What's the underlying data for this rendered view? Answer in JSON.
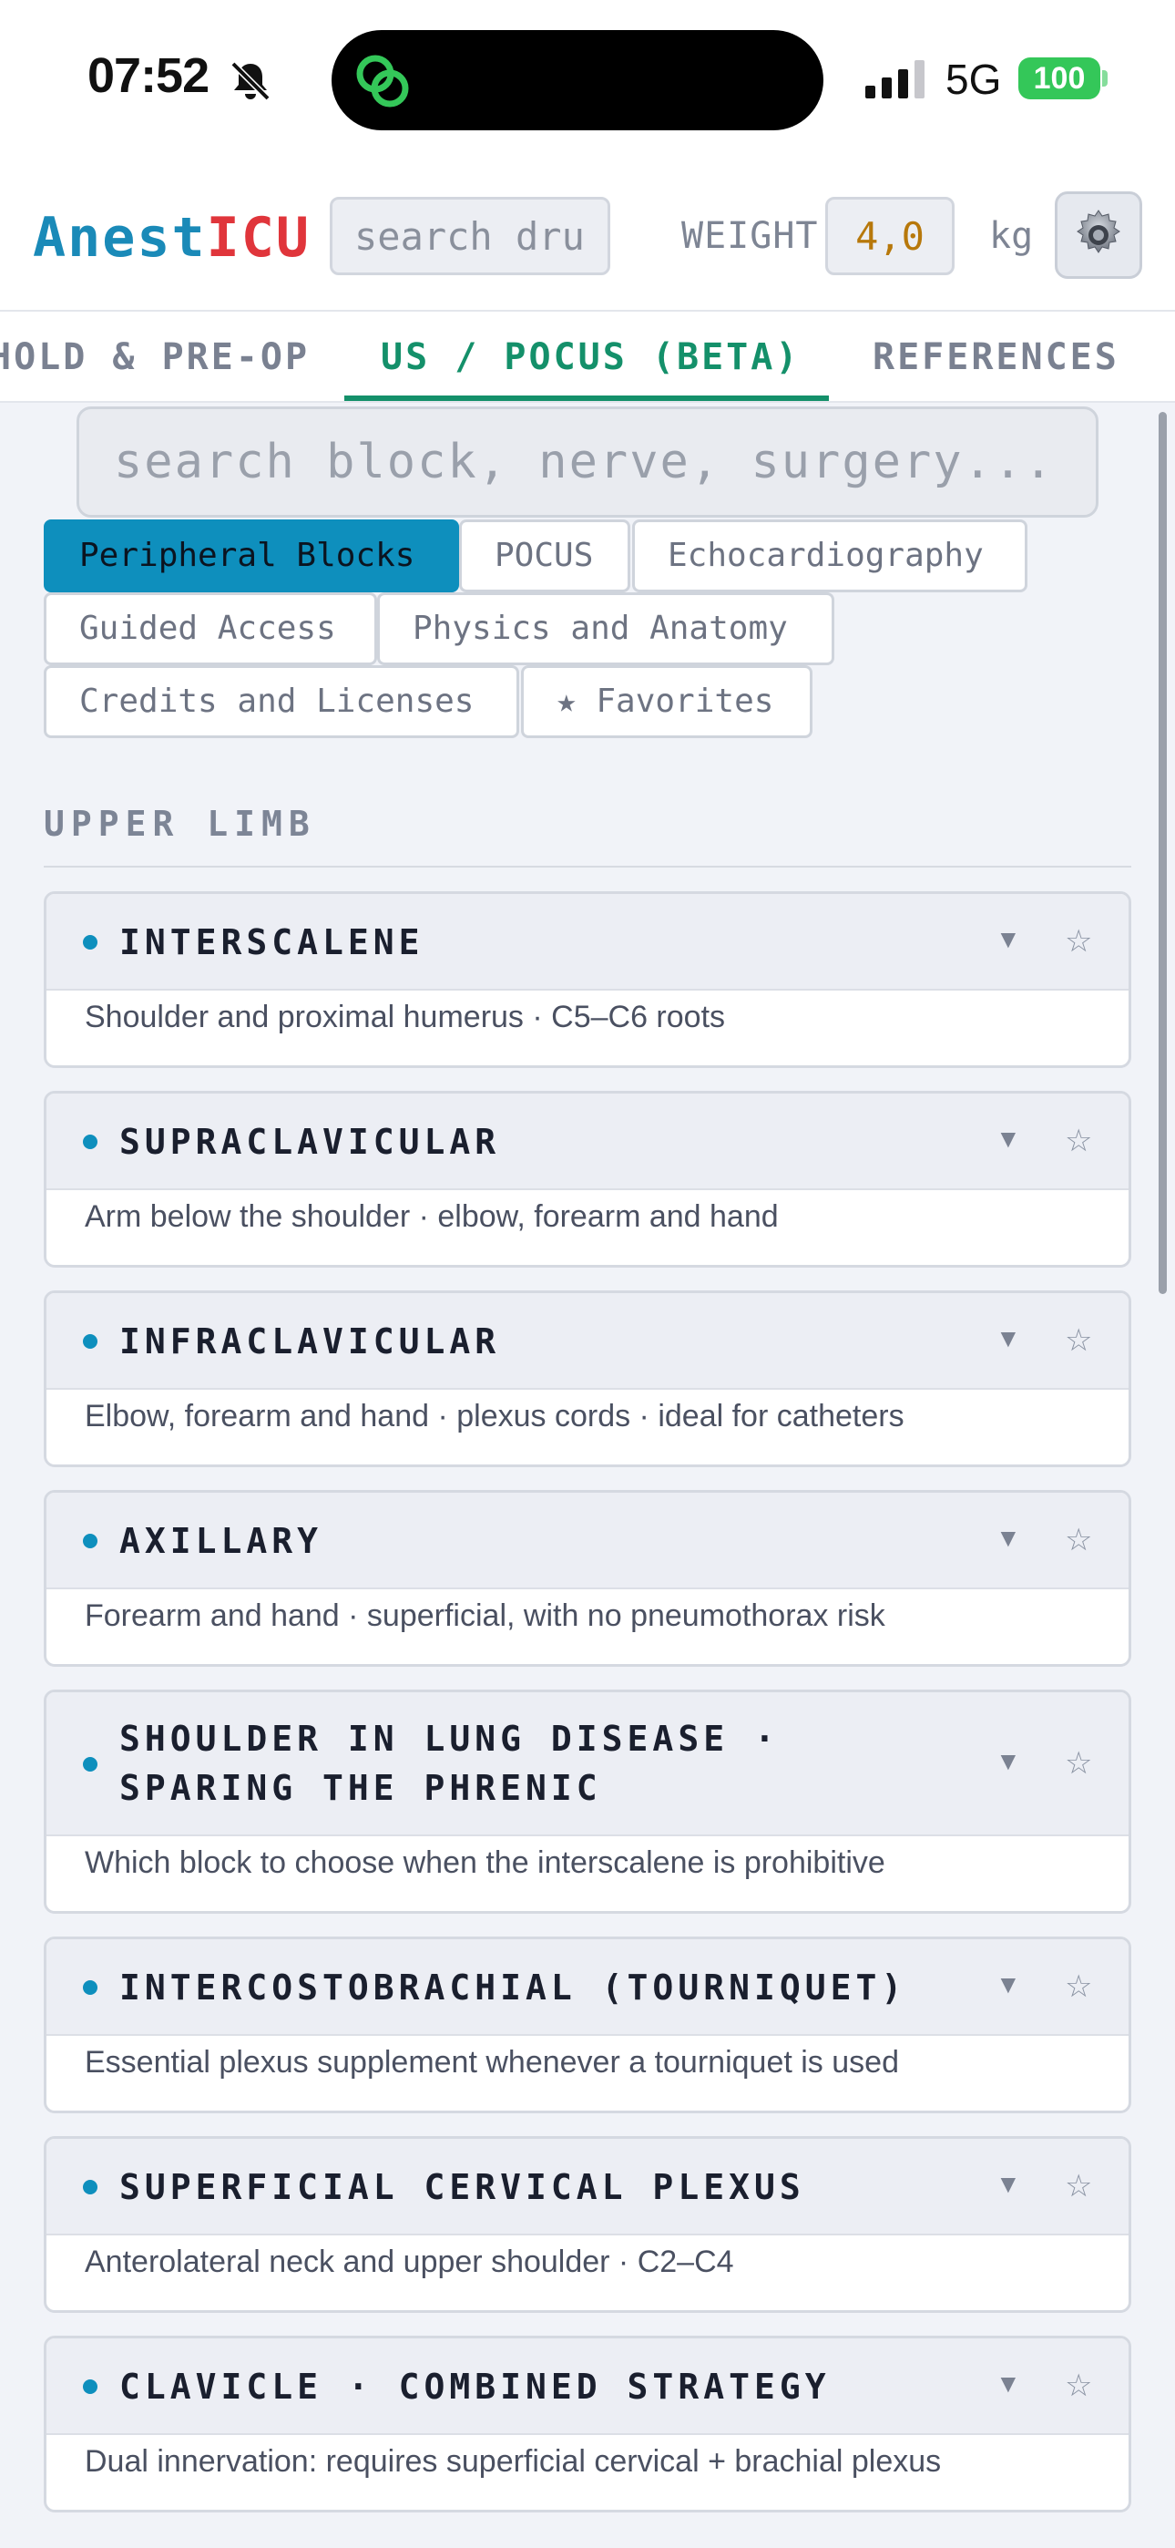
{
  "status_bar": {
    "time": "07:52",
    "network": "5G",
    "battery": "100"
  },
  "header": {
    "logo_part1": "Anest",
    "logo_part2": "ICU",
    "drug_search_placeholder": "search dru",
    "weight_label": "WEIGHT",
    "weight_value": "4,0",
    "weight_unit": "kg",
    "settings_icon": "gear-icon"
  },
  "tabs": [
    {
      "label": "HOLD & PRE-OP",
      "active": false
    },
    {
      "label": "US / POCUS (BETA)",
      "active": true
    },
    {
      "label": "REFERENCES",
      "active": false
    }
  ],
  "block_search_placeholder": "search block, nerve, surgery...",
  "chips": [
    {
      "label": "Peripheral Blocks",
      "active": true
    },
    {
      "label": "POCUS",
      "active": false
    },
    {
      "label": "Echocardiography",
      "active": false
    },
    {
      "label": "Guided Access",
      "active": false
    },
    {
      "label": "Physics and Anatomy",
      "active": false
    },
    {
      "label": "Credits and Licenses",
      "active": false
    },
    {
      "label": "★ Favorites",
      "active": false
    }
  ],
  "section": {
    "title": "UPPER LIMB"
  },
  "cards": [
    {
      "title": "INTERSCALENE",
      "subtitle": "Shoulder and proximal humerus · C5–C6 roots"
    },
    {
      "title": "SUPRACLAVICULAR",
      "subtitle": "Arm below the shoulder · elbow, forearm and hand"
    },
    {
      "title": "INFRACLAVICULAR",
      "subtitle": "Elbow, forearm and hand · plexus cords · ideal for catheters"
    },
    {
      "title": "AXILLARY",
      "subtitle": "Forearm and hand · superficial, with no pneumothorax risk"
    },
    {
      "title": "SHOULDER IN LUNG DISEASE · SPARING THE PHRENIC",
      "subtitle": "Which block to choose when the interscalene is prohibitive"
    },
    {
      "title": "INTERCOSTOBRACHIAL (TOURNIQUET)",
      "subtitle": "Essential plexus supplement whenever a tourniquet is used"
    },
    {
      "title": "SUPERFICIAL CERVICAL PLEXUS",
      "subtitle": "Anterolateral neck and upper shoulder · C2–C4"
    },
    {
      "title": "CLAVICLE · COMBINED STRATEGY",
      "subtitle": "Dual innervation: requires superficial cervical + brachial plexus"
    }
  ],
  "icons": {
    "caret": "▼",
    "star": "☆"
  },
  "colors": {
    "accent": "#0e8fbd",
    "active_tab": "#14906a",
    "logo_red": "#e0353b",
    "weight_value": "#b7780b"
  }
}
